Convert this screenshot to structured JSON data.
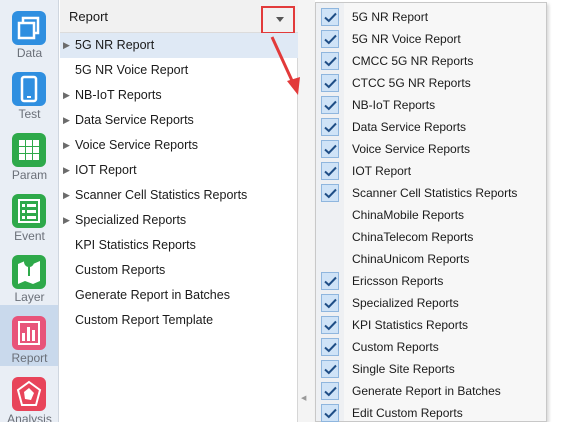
{
  "sidebar": {
    "items": [
      {
        "label": "Data",
        "icon": "data-icon",
        "color": "#2f8fe0"
      },
      {
        "label": "Test",
        "icon": "phone-icon",
        "color": "#2f8fe0"
      },
      {
        "label": "Param",
        "icon": "grid-icon",
        "color": "#2ea94a"
      },
      {
        "label": "Event",
        "icon": "list-icon",
        "color": "#2ea94a"
      },
      {
        "label": "Layer",
        "icon": "map-icon",
        "color": "#2ea94a"
      },
      {
        "label": "Report",
        "icon": "bar-chart-icon",
        "color": "#e8547a",
        "active": true
      },
      {
        "label": "Analysis",
        "icon": "analysis-icon",
        "color": "#e8445a"
      }
    ]
  },
  "report_panel": {
    "title": "Report",
    "items": [
      {
        "label": "5G NR Report",
        "expandable": true,
        "selected": true
      },
      {
        "label": "5G NR Voice Report",
        "expandable": false
      },
      {
        "label": "NB-IoT Reports",
        "expandable": true
      },
      {
        "label": "Data Service Reports",
        "expandable": true
      },
      {
        "label": "Voice Service Reports",
        "expandable": true
      },
      {
        "label": "IOT Report",
        "expandable": true
      },
      {
        "label": "Scanner Cell Statistics Reports",
        "expandable": true
      },
      {
        "label": "Specialized Reports",
        "expandable": true
      },
      {
        "label": "KPI Statistics Reports",
        "expandable": false
      },
      {
        "label": "Custom Reports",
        "expandable": false
      },
      {
        "label": "Generate Report in Batches",
        "expandable": false
      },
      {
        "label": "Custom Report Template",
        "expandable": false
      }
    ]
  },
  "menu": {
    "items": [
      {
        "label": "5G NR Report",
        "checked": true
      },
      {
        "label": "5G NR Voice Report",
        "checked": true
      },
      {
        "label": "CMCC 5G NR Reports",
        "checked": true
      },
      {
        "label": "CTCC 5G NR Reports",
        "checked": true
      },
      {
        "label": "NB-IoT Reports",
        "checked": true
      },
      {
        "label": "Data Service Reports",
        "checked": true
      },
      {
        "label": "Voice Service Reports",
        "checked": true
      },
      {
        "label": "IOT Report",
        "checked": true
      },
      {
        "label": "Scanner Cell Statistics Reports",
        "checked": true
      },
      {
        "label": "ChinaMobile Reports",
        "checked": false
      },
      {
        "label": "ChinaTelecom Reports",
        "checked": false
      },
      {
        "label": "ChinaUnicom Reports",
        "checked": false
      },
      {
        "label": "Ericsson Reports",
        "checked": true
      },
      {
        "label": "Specialized Reports",
        "checked": true
      },
      {
        "label": "KPI Statistics Reports",
        "checked": true
      },
      {
        "label": "Custom Reports",
        "checked": true
      },
      {
        "label": "Single Site Reports",
        "checked": true
      },
      {
        "label": "Generate Report in Batches",
        "checked": true
      },
      {
        "label": "Edit Custom Reports",
        "checked": true
      }
    ]
  },
  "colors": {
    "highlight_box": "#e23a3a",
    "annotation_arrow": "#e23a3a",
    "check_fill": "#cfe3f7"
  }
}
